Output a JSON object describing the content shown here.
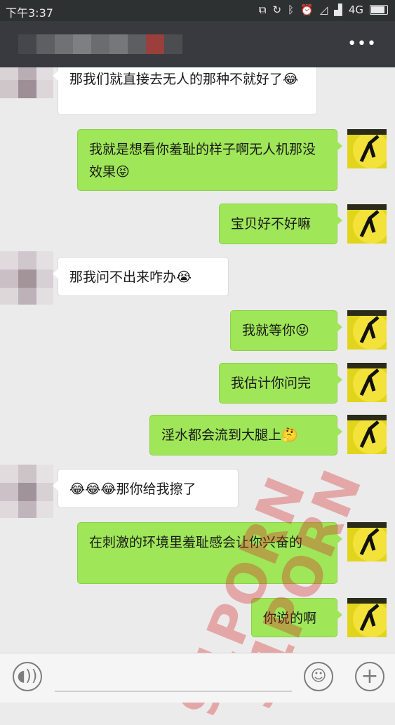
{
  "status": {
    "time": "下午3:37",
    "network": "4G"
  },
  "header": {
    "contact_name": "",
    "more_label": "•••"
  },
  "messages": [
    {
      "side": "in",
      "text": "那我们就直接去无人的那种不就好了😂"
    },
    {
      "side": "out",
      "text": "我就是想看你羞耻的样子啊无人机那没效果😝"
    },
    {
      "side": "out",
      "text": "宝贝好不好嘛"
    },
    {
      "side": "in",
      "text": "那我问不出来咋办😭"
    },
    {
      "side": "out",
      "text": "我就等你😝"
    },
    {
      "side": "out",
      "text": "我估计你问完"
    },
    {
      "side": "out",
      "text": "淫水都会流到大腿上🤔"
    },
    {
      "side": "in",
      "text": "😂😂😂那你给我擦了"
    },
    {
      "side": "out",
      "text": "在刺激的环境里羞耻感会让你兴奋的"
    },
    {
      "side": "out",
      "text": "你说的啊"
    }
  ],
  "watermark": "91PORN",
  "input": {
    "voice_icon": "voice-icon",
    "emoji_icon": "emoji-icon",
    "plus_icon": "plus-icon"
  }
}
